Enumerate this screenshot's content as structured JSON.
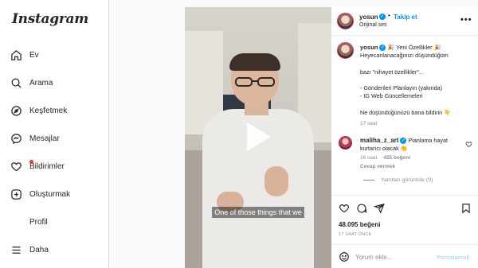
{
  "sidebar": {
    "logo": "Instagram",
    "items": [
      {
        "label": "Ev",
        "icon": "home-icon"
      },
      {
        "label": "Arama",
        "icon": "search-icon"
      },
      {
        "label": "Keşfetmek",
        "icon": "compass-icon"
      },
      {
        "label": "Mesajlar",
        "icon": "messenger-icon"
      },
      {
        "label": "Bildirimler",
        "icon": "heart-icon"
      },
      {
        "label": "Oluşturmak",
        "icon": "plus-square-icon"
      },
      {
        "label": "Profil",
        "icon": "none"
      },
      {
        "label": "Daha",
        "icon": "menu-icon"
      }
    ]
  },
  "post": {
    "username": "yosun",
    "follow_label": "Takip et",
    "audio": "Orijinal ses",
    "separator": "•",
    "video_caption": "One of those things that we",
    "caption_lines": [
      "🎉 Yeni Özellikler 🎉",
      "Heyecanlanacağınızı düşündüğüm",
      "",
      "bazı \"nihayet özellikler\"...",
      "",
      "- Gönderileri Planlayın (yakında)",
      "- IG Web Güncellemeleri",
      "",
      "Ne düşündüğünüzü bana bildirin 👇"
    ],
    "caption_time": "17 saat",
    "likes": "48.095 beğeni",
    "posted_ago": "17 SAAT ÖNCE"
  },
  "comment": {
    "username": "maliha_z_art",
    "text": "Planlama hayat kurtarıcı olacak 👏",
    "time": "16 saat",
    "likes": "455 beğeni",
    "reply_label": "Cevap vermek",
    "view_replies": "Yanıtları görüntüle (9)"
  },
  "comment_input": {
    "placeholder": "Yorum ekle...",
    "post_label": "Postalamak"
  },
  "colors": {
    "accent": "#0095f6",
    "muted": "#8e8e8e",
    "notification": "#ff3040"
  }
}
